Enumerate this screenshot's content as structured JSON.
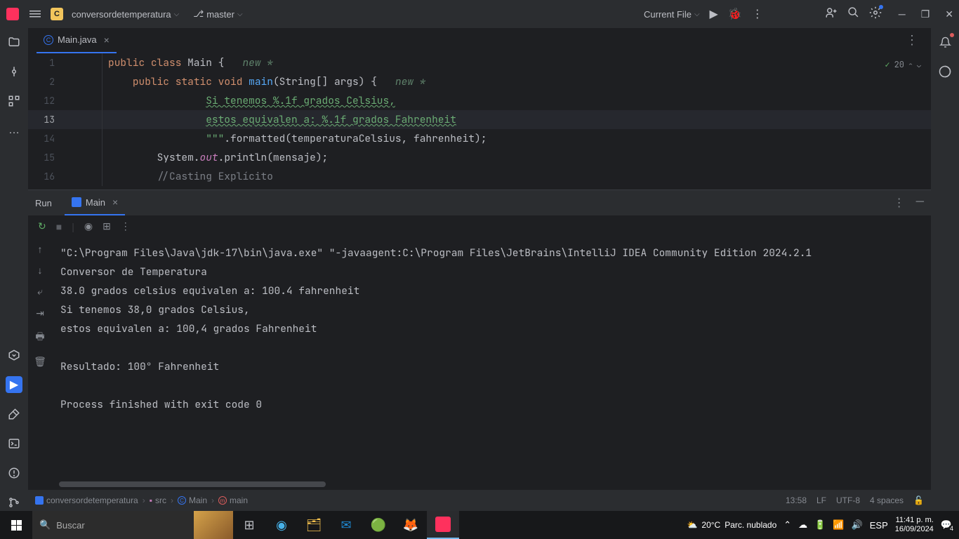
{
  "topbar": {
    "project_badge": "C",
    "project_name": "conversordetemperatura",
    "branch_name": "master",
    "current_file_label": "Current File"
  },
  "tabs": {
    "file_name": "Main.java"
  },
  "editor": {
    "inspections_count": "20",
    "lines": [
      {
        "num": "1"
      },
      {
        "num": "2"
      },
      {
        "num": "12"
      },
      {
        "num": "13"
      },
      {
        "num": "14"
      },
      {
        "num": "15"
      },
      {
        "num": "16"
      }
    ],
    "l1": {
      "kw1": "public",
      "kw2": "class",
      "cls": "Main",
      "brace": " {",
      "hint": "new *"
    },
    "l2": {
      "kw1": "public",
      "kw2": "static",
      "kw3": "void",
      "mth": "main",
      "args": "(String[] args) {",
      "hint": "new *"
    },
    "l12": "Si tenemos %.1f grados Celsius,",
    "l13": "estos equivalen a: %.1f grados Fahrenheit",
    "l14": {
      "triple": "\"\"\"",
      "rest": ".formatted(temperaturaCelsius, fahrenheit);"
    },
    "l15": {
      "p1": "System.",
      "out": "out",
      "p2": ".println(mensaje);"
    },
    "l16": "//Casting Explícito"
  },
  "run": {
    "panel_label": "Run",
    "tab_label": "Main",
    "output": "\"C:\\Program Files\\Java\\jdk-17\\bin\\java.exe\" \"-javaagent:C:\\Program Files\\JetBrains\\IntelliJ IDEA Community Edition 2024.2.1\nConversor de Temperatura\n38.0 grados celsius equivalen a: 100.4 fahrenheit\nSi tenemos 38,0 grados Celsius,\nestos equivalen a: 100,4 grados Fahrenheit\n\nResultado: 100° Fahrenheit\n\nProcess finished with exit code 0"
  },
  "breadcrumb": {
    "p1": "conversordetemperatura",
    "p2": "src",
    "p3": "Main",
    "p4": "main"
  },
  "status": {
    "pos": "13:58",
    "eol": "LF",
    "enc": "UTF-8",
    "indent": "4 spaces"
  },
  "taskbar": {
    "search_placeholder": "Buscar",
    "weather_temp": "20°C",
    "weather_desc": "Parc. nublado",
    "lang": "ESP",
    "time": "11:41 p. m.",
    "date": "16/09/2024",
    "notif_count": "4"
  }
}
